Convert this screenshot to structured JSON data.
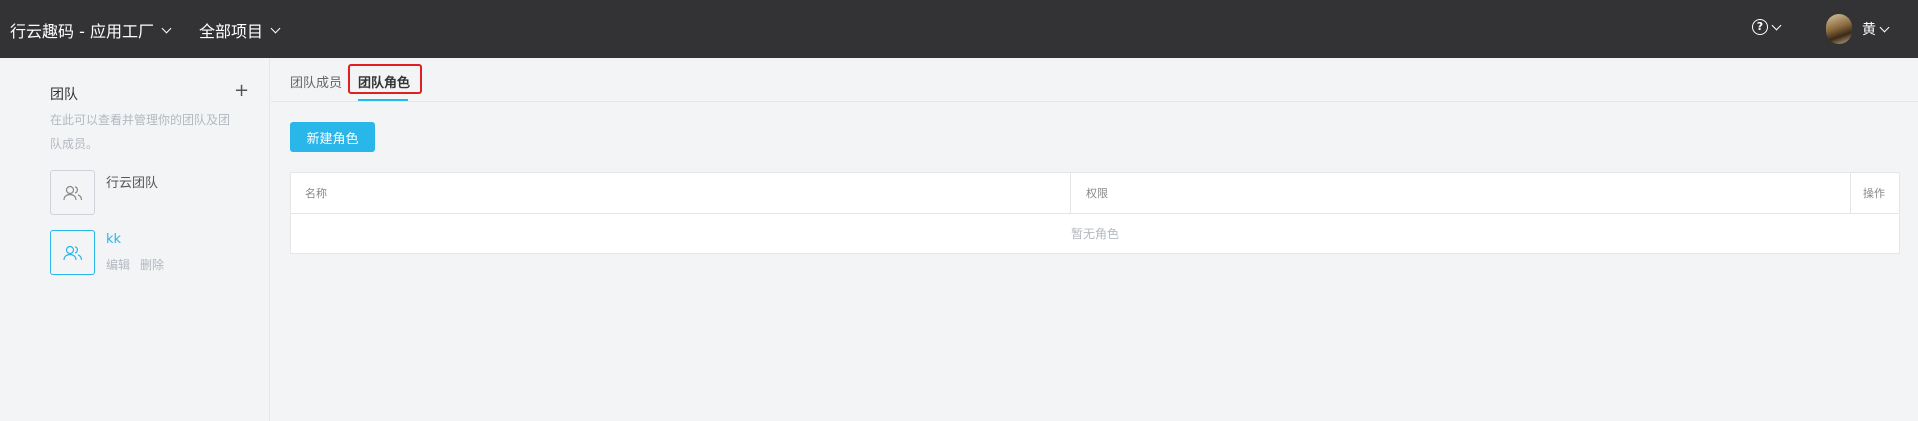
{
  "header": {
    "app_title": "行云趣码 - 应用工厂",
    "project_menu": "全部项目",
    "help_icon": "?",
    "user_name": "黄"
  },
  "sidebar": {
    "title": "团队",
    "add_icon": "+",
    "description": "在此可以查看并管理你的团队及团队成员。",
    "teams": [
      {
        "name": "行云团队",
        "active": false
      },
      {
        "name": "kk",
        "active": true,
        "actions": [
          "编辑",
          "删除"
        ]
      }
    ]
  },
  "tabs": [
    {
      "label": "团队成员",
      "active": false
    },
    {
      "label": "团队角色",
      "active": true
    }
  ],
  "new_role_button": "新建角色",
  "table": {
    "columns": [
      "名称",
      "权限",
      "操作"
    ],
    "empty_text": "暂无角色"
  },
  "colors": {
    "accent": "#29b6e8",
    "topbar": "#333335",
    "highlight": "#e02020"
  }
}
